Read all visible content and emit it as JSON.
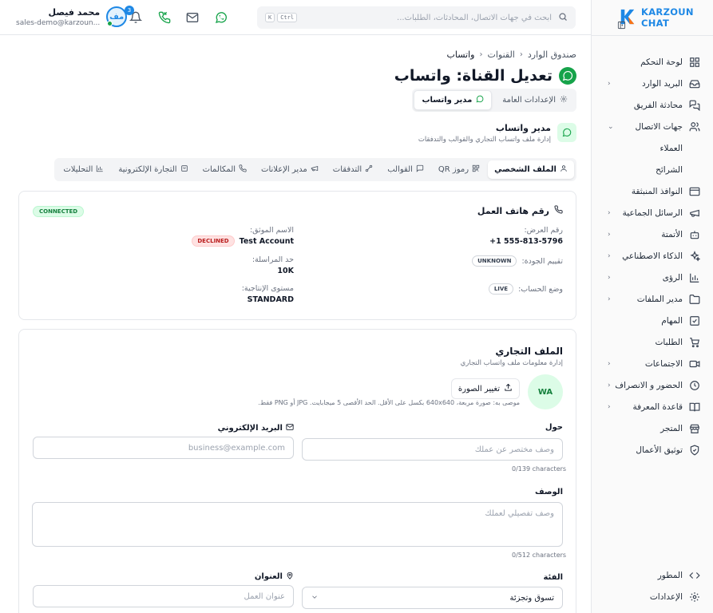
{
  "header": {
    "user_name": "محمد فيصل",
    "user_email": "sales-demo@karzoun...",
    "avatar_initials": "مف",
    "notification_count": "3",
    "search_placeholder": "ابحث في جهات الاتصال، المحادثات، الطلبات...",
    "kbd_k": "K",
    "kbd_ctrl": "Ctrl"
  },
  "breadcrumb": [
    "صندوق الوارد",
    "القنوات",
    "واتساب"
  ],
  "page": {
    "title": "تعديل القناة: واتساب",
    "subtabs": [
      {
        "label": "الإعدادات العامة",
        "active": false
      },
      {
        "label": "مدير واتساب",
        "active": true
      }
    ],
    "section_title": "مدير واتساب",
    "section_desc": "إدارة ملف واتساب التجاري والقوالب والتدفقات"
  },
  "tabs": [
    {
      "label": "الملف الشخصي",
      "icon": "user-icon",
      "active": true
    },
    {
      "label": "رموز QR",
      "icon": "qr-icon",
      "active": false
    },
    {
      "label": "القوالب",
      "icon": "template-icon",
      "active": false
    },
    {
      "label": "التدفقات",
      "icon": "flow-icon",
      "active": false
    },
    {
      "label": "مدير الإعلانات",
      "icon": "megaphone-icon",
      "active": false
    },
    {
      "label": "المكالمات",
      "icon": "phone-icon",
      "active": false
    },
    {
      "label": "التجارة الإلكترونية",
      "icon": "cart-icon",
      "active": false
    },
    {
      "label": "التحليلات",
      "icon": "chart-icon",
      "active": false
    }
  ],
  "phone_card": {
    "title": "رقم هاتف العمل",
    "status": "CONNECTED",
    "display_number_label": "رقم العرض:",
    "display_number": "+1 555-813-5796",
    "verified_name_label": "الاسم الموثق:",
    "verified_name": "Test Account",
    "verified_status": "DECLINED",
    "quality_label": "تقييم الجودة:",
    "quality_value": "UNKNOWN",
    "limit_label": "حد المراسلة:",
    "limit_value": "10K",
    "mode_label": "وضع الحساب:",
    "mode_value": "LIVE",
    "throughput_label": "مستوى الإنتاجية:",
    "throughput_value": "STANDARD"
  },
  "business_card": {
    "title": "الملف التجاري",
    "desc": "إدارة معلومات ملف واتساب التجاري",
    "avatar": "WA",
    "change_photo": "تغيير الصورة",
    "photo_hint": "موصى به: صورة مربعة، 640x640 بكسل على الأقل. الحد الأقصى 5 ميجابايت. JPG أو PNG فقط.",
    "about_label": "حول",
    "about_placeholder": "وصف مختصر عن عملك",
    "about_counter": "0/139 characters",
    "email_label": "البريد الإلكتروني",
    "email_placeholder": "business@example.com",
    "description_label": "الوصف",
    "description_placeholder": "وصف تفصيلي لعملك",
    "description_counter": "0/512 characters",
    "category_label": "الفئة",
    "category_value": "تسوق وتجزئة",
    "address_label": "العنوان",
    "address_placeholder": "عنوان العمل"
  },
  "sidebar": {
    "brand": "KARZOUN CHAT",
    "items": [
      {
        "label": "لوحة التحكم",
        "icon": "dashboard-icon",
        "chevron": false
      },
      {
        "label": "البريد الوارد",
        "icon": "inbox-icon",
        "chevron": true
      },
      {
        "label": "محادثة الفريق",
        "icon": "team-chat-icon",
        "chevron": false
      },
      {
        "label": "جهات الاتصال",
        "icon": "contacts-icon",
        "chevron": true,
        "expanded": true
      },
      {
        "label": "العملاء",
        "sub": true
      },
      {
        "label": "الشرائح",
        "sub": true
      },
      {
        "label": "النوافذ المنبثقة",
        "icon": "popup-icon",
        "chevron": false
      },
      {
        "label": "الرسائل الجماعية",
        "icon": "broadcast-icon",
        "chevron": true
      },
      {
        "label": "الأتمتة",
        "icon": "bot-icon",
        "chevron": true
      },
      {
        "label": "الذكاء الاصطناعي",
        "icon": "sparkles-icon",
        "chevron": true
      },
      {
        "label": "الرؤى",
        "icon": "bar-chart-icon",
        "chevron": true
      },
      {
        "label": "مدير الملفات",
        "icon": "folder-icon",
        "chevron": true
      },
      {
        "label": "المهام",
        "icon": "task-icon",
        "chevron": false
      },
      {
        "label": "الطلبات",
        "icon": "cart-icon",
        "chevron": false
      },
      {
        "label": "الاجتماعات",
        "icon": "video-icon",
        "chevron": true
      },
      {
        "label": "الحضور و الانصراف",
        "icon": "clock-icon",
        "chevron": true
      },
      {
        "label": "قاعدة المعرفة",
        "icon": "book-icon",
        "chevron": true
      },
      {
        "label": "المتجر",
        "icon": "store-icon",
        "chevron": false
      },
      {
        "label": "توثيق الأعمال",
        "icon": "shield-icon",
        "chevron": false
      }
    ],
    "bottom": [
      {
        "label": "المطور",
        "icon": "code-icon"
      },
      {
        "label": "الإعدادات",
        "icon": "gear-icon"
      }
    ]
  }
}
